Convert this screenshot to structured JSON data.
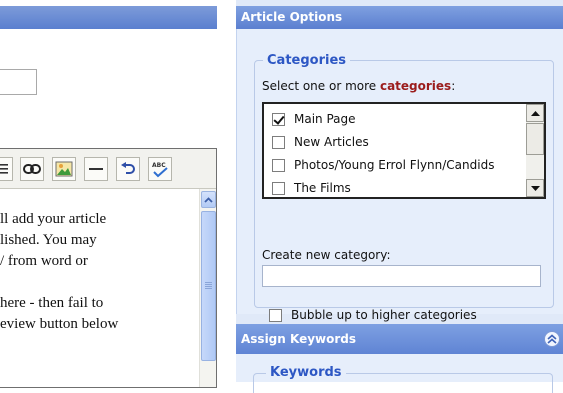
{
  "editor": {
    "toolbar": {
      "buttons": [
        {
          "icon": "justify-icon"
        },
        {
          "icon": "link-icon"
        },
        {
          "icon": "image-icon"
        },
        {
          "icon": "horizontal-rule-icon"
        },
        {
          "icon": "undo-icon"
        },
        {
          "icon": "spellcheck-icon",
          "label": "ABC"
        }
      ]
    },
    "lines": [
      "ll add your article",
      "lished. You may",
      "/ from word or",
      "",
      " here - then fail to",
      "eview button below"
    ]
  },
  "options": {
    "header": "Article Options",
    "categories": {
      "legend": "Categories",
      "hint_prefix": "Select one or more ",
      "hint_emph": "categories",
      "hint_suffix": ":",
      "items": [
        {
          "label": "Main Page",
          "checked": true
        },
        {
          "label": "New Articles",
          "checked": false
        },
        {
          "label": "Photos/Young Errol Flynn/Candids",
          "checked": false
        },
        {
          "label": "The Films",
          "checked": false
        }
      ],
      "new_category_label": "Create new category:",
      "new_category_value": "",
      "bubble_label": "Bubble up to higher categories",
      "bubble_checked": false
    }
  },
  "keywords": {
    "header": "Assign Keywords",
    "legend": "Keywords"
  },
  "colors": {
    "header_blue": "#5b7fd0",
    "legend_blue": "#2d57c4",
    "emphasis_red": "#9b1c1c",
    "panel_bg": "#e6eefb"
  }
}
